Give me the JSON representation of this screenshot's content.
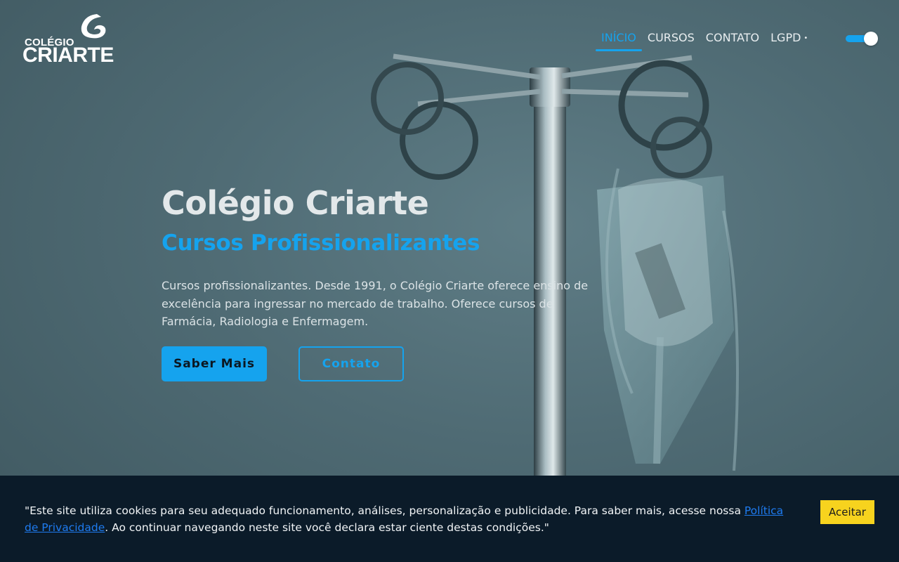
{
  "brand": {
    "logo_line1": "COLÉGIO",
    "logo_line2": "CRIARTE"
  },
  "nav": {
    "items": [
      {
        "label": "INÍCIO",
        "active": true
      },
      {
        "label": "CURSOS",
        "active": false
      },
      {
        "label": "CONTATO",
        "active": false
      },
      {
        "label": "LGPD",
        "active": false,
        "suffix": "•"
      }
    ],
    "theme_toggle_on": true
  },
  "hero": {
    "title": "Colégio Criarte",
    "subtitle": "Cursos Profissionalizantes",
    "description": "Cursos profissionalizantes. Desde 1991, o Colégio Criarte oferece ensino de excelência para ingressar no mercado de trabalho. Oferece cursos de Farmácia, Radiologia e Enfermagem.",
    "primary_button": "Saber Mais",
    "secondary_button": "Contato"
  },
  "cookie": {
    "text_before": "\"Este site utiliza cookies para seu adequado funcionamento, análises, personalização e publicidade. Para saber mais, acesse nossa ",
    "link_text": "Política de Privacidade",
    "text_after": ". Ao continuar navegando neste site você declara estar ciente destas condições.\"",
    "accept_button": "Aceitar"
  },
  "colors": {
    "accent": "#15a3ee",
    "cookie_bg": "#0b1b29",
    "accept_bg": "#f7d31e"
  }
}
